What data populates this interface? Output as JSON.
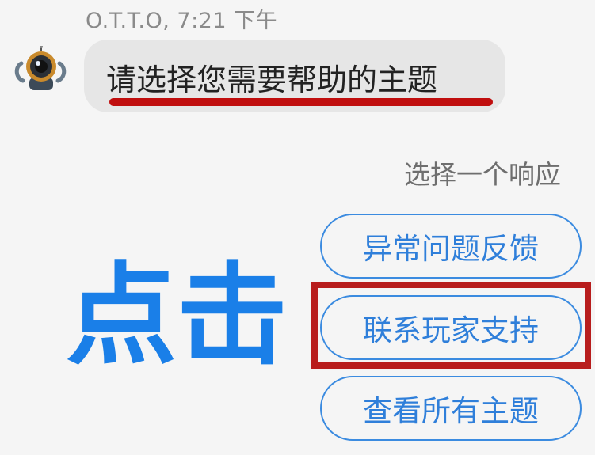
{
  "message": {
    "sender_meta": "O.T.T.O, 7:21 下午",
    "text": "请选择您需要帮助的主题"
  },
  "prompt": "选择一个响应",
  "replies": [
    {
      "label": "异常问题反馈",
      "highlighted": false
    },
    {
      "label": "联系玩家支持",
      "highlighted": true
    },
    {
      "label": "查看所有主题",
      "highlighted": false
    }
  ],
  "annotation": {
    "click_label": "点击",
    "click_label_color": "#1a7fe8",
    "highlight_color": "#b81d1d"
  },
  "colors": {
    "accent": "#3b8be0",
    "bubble": "#e6e6e6",
    "background": "#f5f5f5"
  },
  "icons": {
    "avatar": "robot-avatar-icon"
  }
}
